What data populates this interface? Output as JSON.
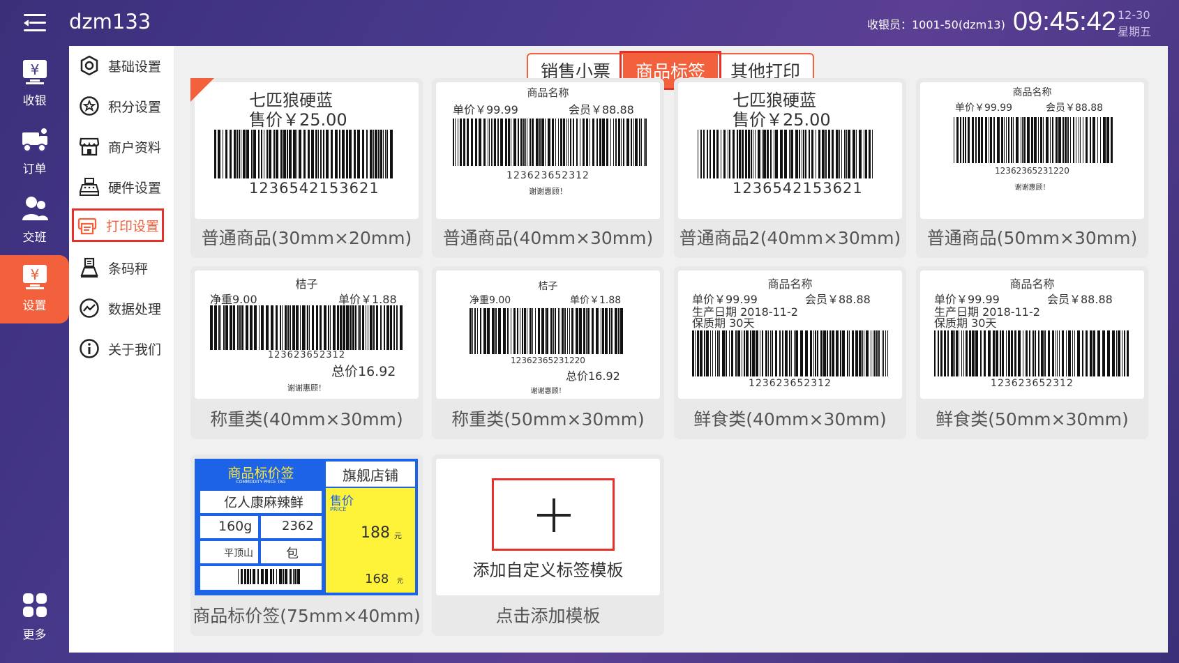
{
  "app": {
    "title": "dzm133",
    "cashier": "收银员：1001-50(dzm13)",
    "time": "09:45:42",
    "date": "12-30",
    "weekday": "星期五"
  },
  "nav": [
    {
      "label": "收银",
      "icon": "cashier-icon"
    },
    {
      "label": "订单",
      "icon": "order-icon"
    },
    {
      "label": "交班",
      "icon": "shift-icon"
    },
    {
      "label": "设置",
      "icon": "settings-icon"
    },
    {
      "label": "更多",
      "icon": "more-icon"
    }
  ],
  "menu": [
    {
      "label": "基础设置",
      "icon": "gear-icon"
    },
    {
      "label": "积分设置",
      "icon": "points-icon"
    },
    {
      "label": "商户资料",
      "icon": "store-icon"
    },
    {
      "label": "硬件设置",
      "icon": "hardware-icon"
    },
    {
      "label": "打印设置",
      "icon": "printer-icon"
    },
    {
      "label": "条码秤",
      "icon": "scale-icon"
    },
    {
      "label": "数据处理",
      "icon": "data-icon"
    },
    {
      "label": "关于我们",
      "icon": "info-icon"
    }
  ],
  "tabs": [
    "销售小票",
    "商品标签",
    "其他打印"
  ],
  "templates": {
    "c1": {
      "caption": "普通商品(30mm×20mm)",
      "name": "七匹狼硬蓝",
      "price": "售价￥25.00",
      "code": "1236542153621"
    },
    "c2": {
      "caption": "普通商品(40mm×30mm)",
      "name": "商品名称",
      "unit": "单价￥99.99",
      "member": "会员￥88.88",
      "code": "123623652312",
      "thanks": "谢谢惠顾！"
    },
    "c3": {
      "caption": "普通商品2(40mm×30mm)",
      "name": "七匹狼硬蓝",
      "price": "售价￥25.00",
      "code": "1236542153621"
    },
    "c4": {
      "caption": "普通商品(50mm×30mm)",
      "name": "商品名称",
      "unit": "单价￥99.99",
      "member": "会员￥88.88",
      "code": "12362365231220",
      "thanks": "谢谢惠顾！"
    },
    "c5": {
      "caption": "称重类(40mm×30mm)",
      "name": "桔子",
      "weight": "净重9.00",
      "unit": "单价￥1.88",
      "code": "123623652312",
      "total": "总价16.92",
      "thanks": "谢谢惠顾！"
    },
    "c6": {
      "caption": "称重类(50mm×30mm)",
      "name": "桔子",
      "weight": "净重9.00",
      "unit": "单价￥1.88",
      "code": "12362365231220",
      "total": "总价16.92",
      "thanks": "谢谢惠顾！"
    },
    "c7": {
      "caption": "鲜食类(40mm×30mm)",
      "name": "商品名称",
      "unit": "单价￥99.99",
      "member": "会员￥88.88",
      "prod": "生产日期 2018-11-2",
      "shelf": "保质期 30天",
      "code": "123623652312"
    },
    "c8": {
      "caption": "鲜食类(50mm×30mm)",
      "name": "商品名称",
      "unit": "单价￥99.99",
      "member": "会员￥88.88",
      "prod": "生产日期 2018-11-2",
      "shelf": "保质期 30天",
      "code": "123623652312"
    },
    "c9": {
      "caption": "商品标价签(75mm×40mm)",
      "title": "商品标价签",
      "subtitle": "COMMODITY PRICE TAG",
      "shop": "旗舰店铺",
      "product": "亿人康麻辣鲜",
      "spec": "160g",
      "num": "2362",
      "origin": "平顶山",
      "unitname": "包",
      "price_label": "售价",
      "price_en": "PRICE",
      "price": "188",
      "member_price": "168",
      "yuan": "元"
    },
    "add": {
      "label": "添加自定义标签模板",
      "caption": "点击添加模板"
    }
  }
}
